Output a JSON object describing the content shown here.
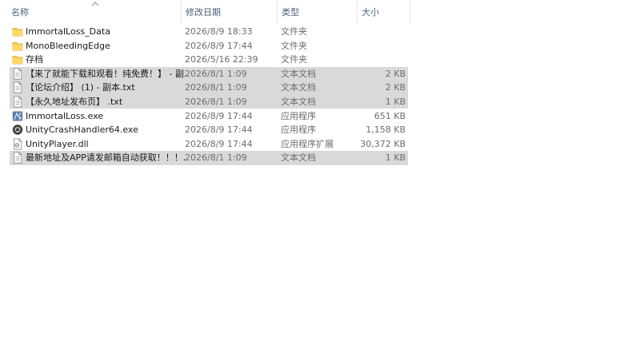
{
  "columns": {
    "name": "名称",
    "date": "修改日期",
    "type": "类型",
    "size": "大小"
  },
  "files": [
    {
      "name": "ImmortalLoss_Data",
      "date": "2026/8/9 18:33",
      "type": "文件夹",
      "size": "",
      "icon": "folder-icon",
      "selected": false
    },
    {
      "name": "MonoBleedingEdge",
      "date": "2026/8/9 17:44",
      "type": "文件夹",
      "size": "",
      "icon": "folder-icon",
      "selected": false
    },
    {
      "name": "存档",
      "date": "2026/5/16 22:39",
      "type": "文件夹",
      "size": "",
      "icon": "folder-icon",
      "selected": false
    },
    {
      "name": "【来了就能下载和观看！纯免费！】 - 副...",
      "date": "2026/8/1 1:09",
      "type": "文本文档",
      "size": "2 KB",
      "icon": "text-file-icon",
      "selected": true
    },
    {
      "name": "【论坛介绍】 (1) - 副本.txt",
      "date": "2026/8/1 1:09",
      "type": "文本文档",
      "size": "2 KB",
      "icon": "text-file-icon",
      "selected": true
    },
    {
      "name": "【永久地址发布页】 .txt",
      "date": "2026/8/1 1:09",
      "type": "文本文档",
      "size": "1 KB",
      "icon": "text-file-icon",
      "selected": true
    },
    {
      "name": "ImmortalLoss.exe",
      "date": "2026/8/9 17:44",
      "type": "应用程序",
      "size": "651 KB",
      "icon": "game-exe-icon",
      "selected": false
    },
    {
      "name": "UnityCrashHandler64.exe",
      "date": "2026/8/9 17:44",
      "type": "应用程序",
      "size": "1,158 KB",
      "icon": "unity-exe-icon",
      "selected": false
    },
    {
      "name": "UnityPlayer.dll",
      "date": "2026/8/9 17:44",
      "type": "应用程序扩展",
      "size": "30,372 KB",
      "icon": "dll-file-icon",
      "selected": false
    },
    {
      "name": "最新地址及APP请发邮箱自动获取！！！...",
      "date": "2026/8/1 1:09",
      "type": "文本文档",
      "size": "1 KB",
      "icon": "text-file-icon",
      "selected": true
    }
  ]
}
